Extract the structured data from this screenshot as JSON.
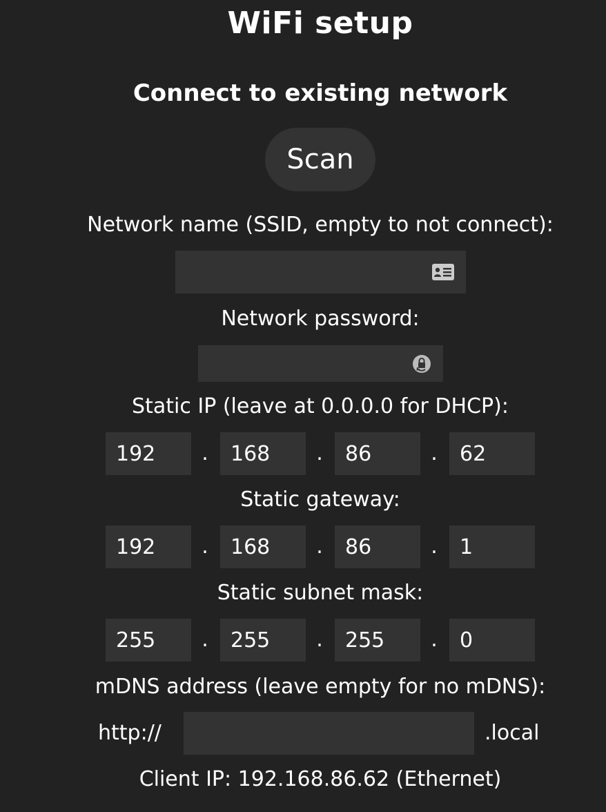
{
  "header": {
    "title": "WiFi setup",
    "subtitle": "Connect to existing network"
  },
  "scan": {
    "label": "Scan"
  },
  "ssid": {
    "label": "Network name (SSID, empty to not connect):",
    "value": "",
    "icon": "contact-card-icon"
  },
  "password": {
    "label": "Network password:",
    "value": "",
    "icon": "password-key-icon"
  },
  "static_ip": {
    "label": "Static IP (leave at 0.0.0.0 for DHCP):",
    "octets": [
      "192",
      "168",
      "86",
      "62"
    ]
  },
  "gateway": {
    "label": "Static gateway:",
    "octets": [
      "192",
      "168",
      "86",
      "1"
    ]
  },
  "subnet": {
    "label": "Static subnet mask:",
    "octets": [
      "255",
      "255",
      "255",
      "0"
    ]
  },
  "separator": ".",
  "mdns": {
    "label": "mDNS address (leave empty for no mDNS):",
    "prefix": "http://",
    "value": "",
    "suffix": ".local"
  },
  "client_ip": {
    "text": "Client IP: 192.168.86.62 (Ethernet)"
  },
  "colors": {
    "background": "#222222",
    "field": "#333333",
    "text": "#ffffff",
    "icon": "#cccccc"
  }
}
